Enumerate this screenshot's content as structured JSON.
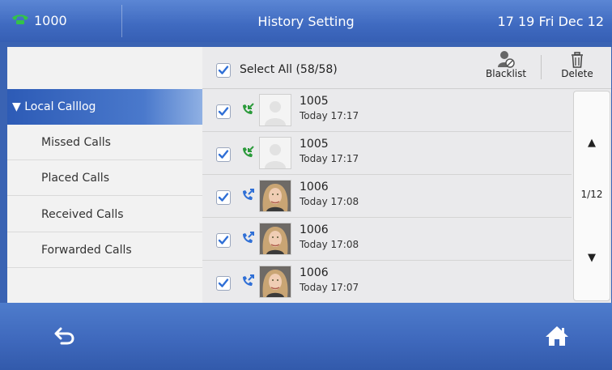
{
  "status_bar": {
    "extension": "1000",
    "title": "History Setting",
    "clock": "17 19 Fri Dec 12"
  },
  "sidebar": {
    "items": [
      {
        "label": "▼ Local Calllog",
        "active": true
      },
      {
        "label": "Missed Calls"
      },
      {
        "label": "Placed Calls"
      },
      {
        "label": "Received Calls"
      },
      {
        "label": "Forwarded Calls"
      }
    ]
  },
  "toolbar": {
    "select_all_label": "Select All (58/58)",
    "blacklist_label": "Blacklist",
    "delete_label": "Delete"
  },
  "entries": [
    {
      "number": "1005",
      "time": "Today 17:17",
      "direction_icon": "received-call-icon",
      "avatar": "default-avatar",
      "checked": true
    },
    {
      "number": "1005",
      "time": "Today 17:17",
      "direction_icon": "received-call-icon",
      "avatar": "default-avatar",
      "checked": true
    },
    {
      "number": "1006",
      "time": "Today 17:08",
      "direction_icon": "placed-call-icon",
      "avatar": "photo-avatar",
      "checked": true
    },
    {
      "number": "1006",
      "time": "Today 17:08",
      "direction_icon": "placed-call-icon",
      "avatar": "photo-avatar",
      "checked": true
    },
    {
      "number": "1006",
      "time": "Today 17:07",
      "direction_icon": "placed-call-icon",
      "avatar": "photo-avatar",
      "checked": true
    }
  ],
  "pager": {
    "up_glyph": "▲",
    "page": "1/12",
    "down_glyph": "▼"
  },
  "colors": {
    "accent_blue": "#3f6ac0",
    "checkbox_blue": "#2f6fd6",
    "received_green": "#2a9a3a",
    "placed_blue": "#2f6fd6"
  }
}
